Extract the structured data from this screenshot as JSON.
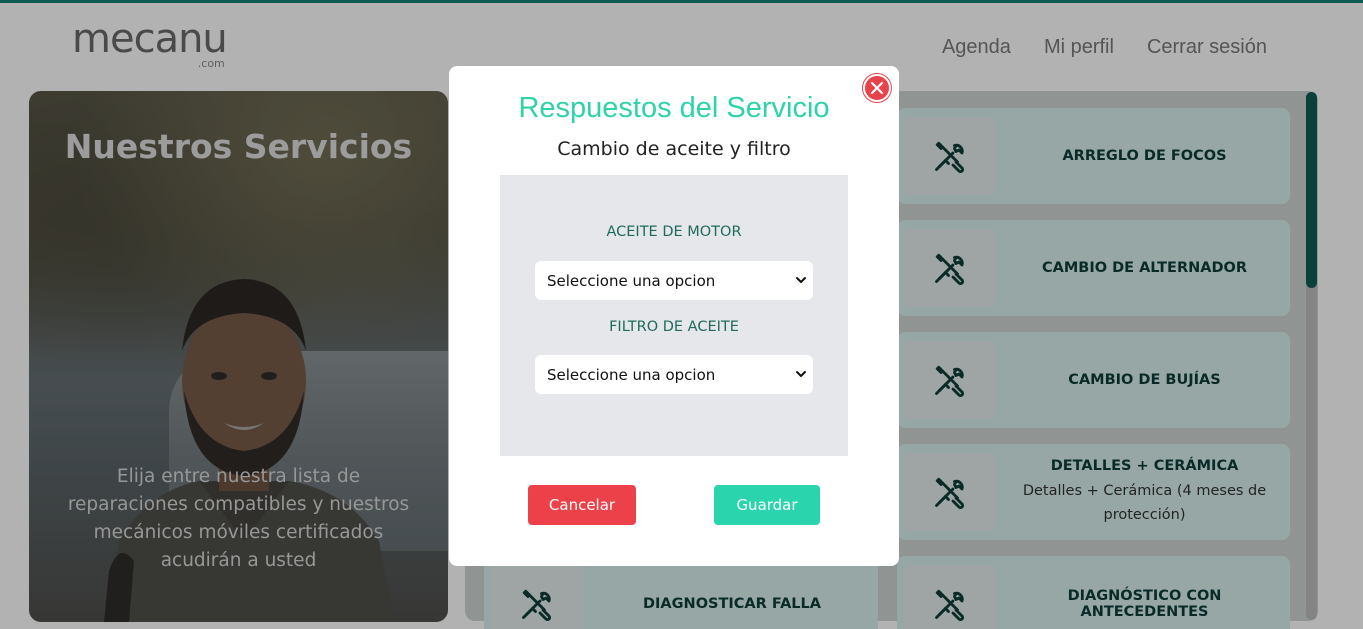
{
  "header": {
    "logo_main": "mecanu",
    "logo_sub": ".com",
    "nav": [
      "Agenda",
      "Mi perfil",
      "Cerrar sesión"
    ]
  },
  "hero": {
    "title": "Nuestros Servicios",
    "description": "Elija entre nuestra lista de reparaciones compatibles y nuestros mecánicos móviles certificados acudirán a usted"
  },
  "services": [
    {
      "title": "ARREGLO DE FOCOS",
      "subtitle": ""
    },
    {
      "title": "CAMBIO DE ALTERNADOR",
      "subtitle": ""
    },
    {
      "title": "CAMBIO DE BUJÍAS",
      "subtitle": ""
    },
    {
      "title": "DETALLES + CERÁMICA",
      "subtitle": "Detalles + Cerámica (4 meses de protección)"
    },
    {
      "title": "DIAGNOSTICAR FALLA",
      "subtitle": ""
    },
    {
      "title": "DIAGNÓSTICO CON ANTECEDENTES",
      "subtitle": ""
    }
  ],
  "modal": {
    "title": "Respuestos del Servicio",
    "subtitle": "Cambio de aceite y filtro",
    "fields": [
      {
        "label": "ACEITE DE MOTOR",
        "value": "Seleccione una opcion"
      },
      {
        "label": "FILTRO DE ACEITE",
        "value": "Seleccione una opcion"
      }
    ],
    "cancel_label": "Cancelar",
    "save_label": "Guardar"
  },
  "colors": {
    "accent": "#2ed3a9",
    "brand_dark": "#0d5c4f",
    "danger": "#ec4148",
    "card_bg": "#d7f0ec"
  },
  "icons": {
    "service_icon": "wrench-screwdriver-icon",
    "close_icon": "close-icon",
    "select_icon": "chevron-down-icon"
  }
}
